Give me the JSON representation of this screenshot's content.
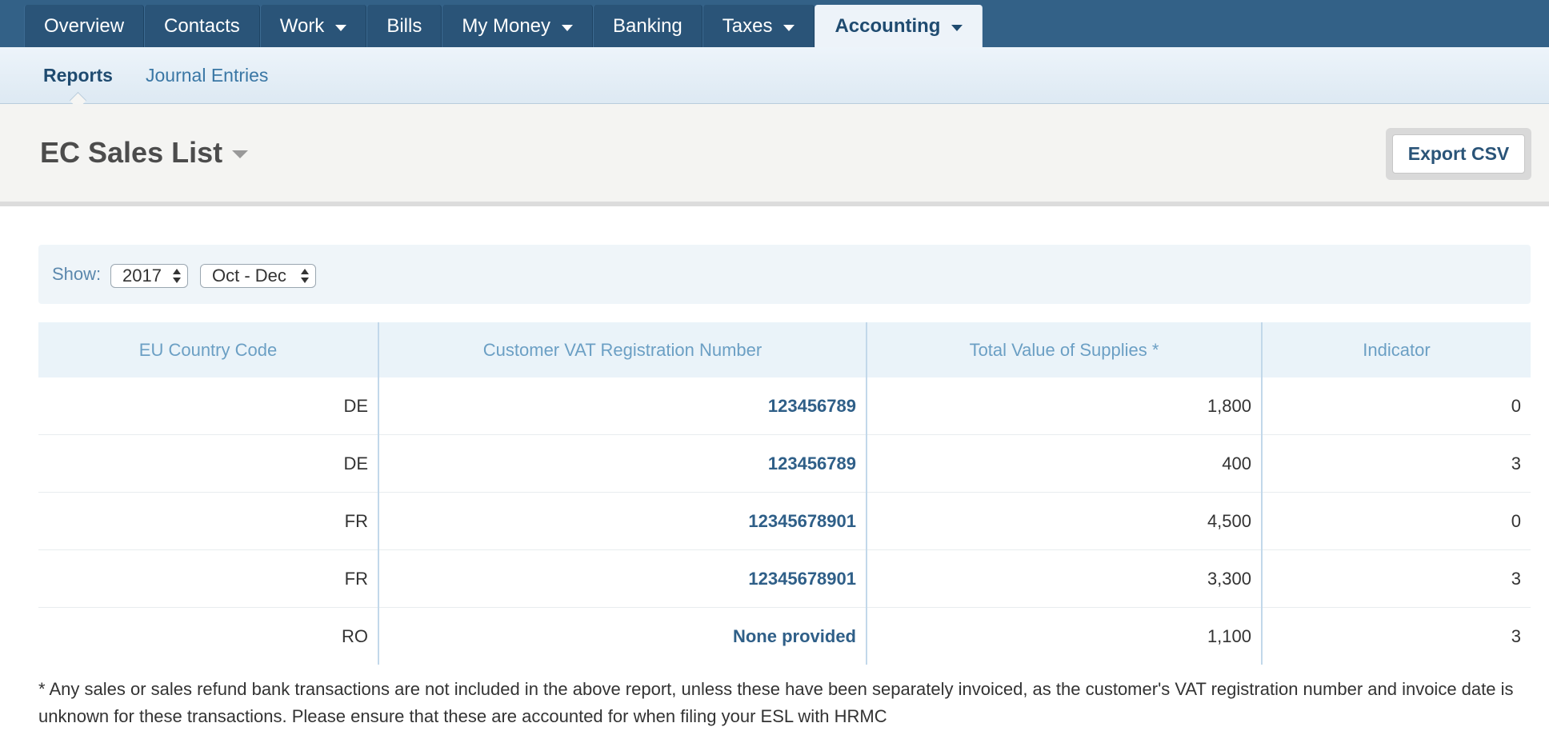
{
  "topnav": {
    "tabs": [
      {
        "label": "Overview",
        "dropdown": false,
        "active": false
      },
      {
        "label": "Contacts",
        "dropdown": false,
        "active": false
      },
      {
        "label": "Work",
        "dropdown": true,
        "active": false
      },
      {
        "label": "Bills",
        "dropdown": false,
        "active": false
      },
      {
        "label": "My Money",
        "dropdown": true,
        "active": false
      },
      {
        "label": "Banking",
        "dropdown": false,
        "active": false
      },
      {
        "label": "Taxes",
        "dropdown": true,
        "active": false
      },
      {
        "label": "Accounting",
        "dropdown": true,
        "active": true
      }
    ]
  },
  "subnav": {
    "items": [
      {
        "label": "Reports",
        "active": true
      },
      {
        "label": "Journal Entries",
        "active": false
      }
    ]
  },
  "page": {
    "title": "EC Sales List",
    "export_label": "Export CSV"
  },
  "filter": {
    "show_label": "Show:",
    "year": "2017",
    "period": "Oct - Dec"
  },
  "table": {
    "headers": [
      "EU Country Code",
      "Customer VAT Registration Number",
      "Total Value of Supplies *",
      "Indicator"
    ],
    "rows": [
      {
        "country": "DE",
        "vat": "123456789",
        "total": "1,800",
        "indicator": "0"
      },
      {
        "country": "DE",
        "vat": "123456789",
        "total": "400",
        "indicator": "3"
      },
      {
        "country": "FR",
        "vat": "12345678901",
        "total": "4,500",
        "indicator": "0"
      },
      {
        "country": "FR",
        "vat": "12345678901",
        "total": "3,300",
        "indicator": "3"
      },
      {
        "country": "RO",
        "vat": "None provided",
        "total": "1,100",
        "indicator": "3"
      }
    ]
  },
  "footnote": "* Any sales or sales refund bank transactions are not included in the above report, unless these have been separately invoiced, as the customer's VAT registration number and invoice date is unknown for these transactions. Please ensure that these are accounted for when filing your ESL with HRMC",
  "colors": {
    "nav_bar": "#336187",
    "nav_tab": "#2a5478",
    "subnav_bg": "#edf4fa",
    "link": "#2f5f88",
    "header_text": "#6b9fc4"
  }
}
